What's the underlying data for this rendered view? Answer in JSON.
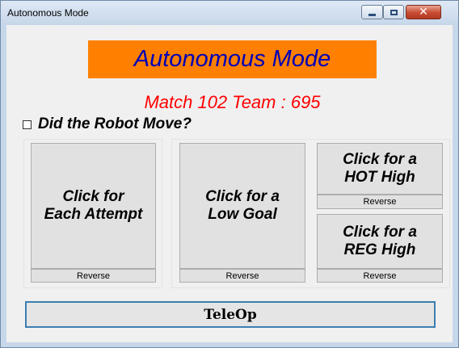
{
  "window": {
    "title": "Autonomous Mode"
  },
  "header": {
    "banner_text": "Autonomous Mode",
    "match_info": "Match 102  Team : 695"
  },
  "robot_move": {
    "label": "Did the Robot Move?",
    "checked": false
  },
  "buttons": {
    "attempt": "Click for\nEach Attempt",
    "low_goal": "Click for a\nLow Goal",
    "hot_high": "Click for a\nHOT High",
    "reg_high": "Click for a\nREG High",
    "reverse": "Reverse",
    "teleop": "TeleOp"
  },
  "colors": {
    "banner_bg": "#ff8000",
    "banner_text": "#0000b8",
    "match_text": "#ff0000",
    "teleop_border": "#3c7fb1"
  },
  "icons": {
    "minimize": "minimize-icon",
    "maximize": "maximize-icon",
    "close": "close-icon"
  }
}
